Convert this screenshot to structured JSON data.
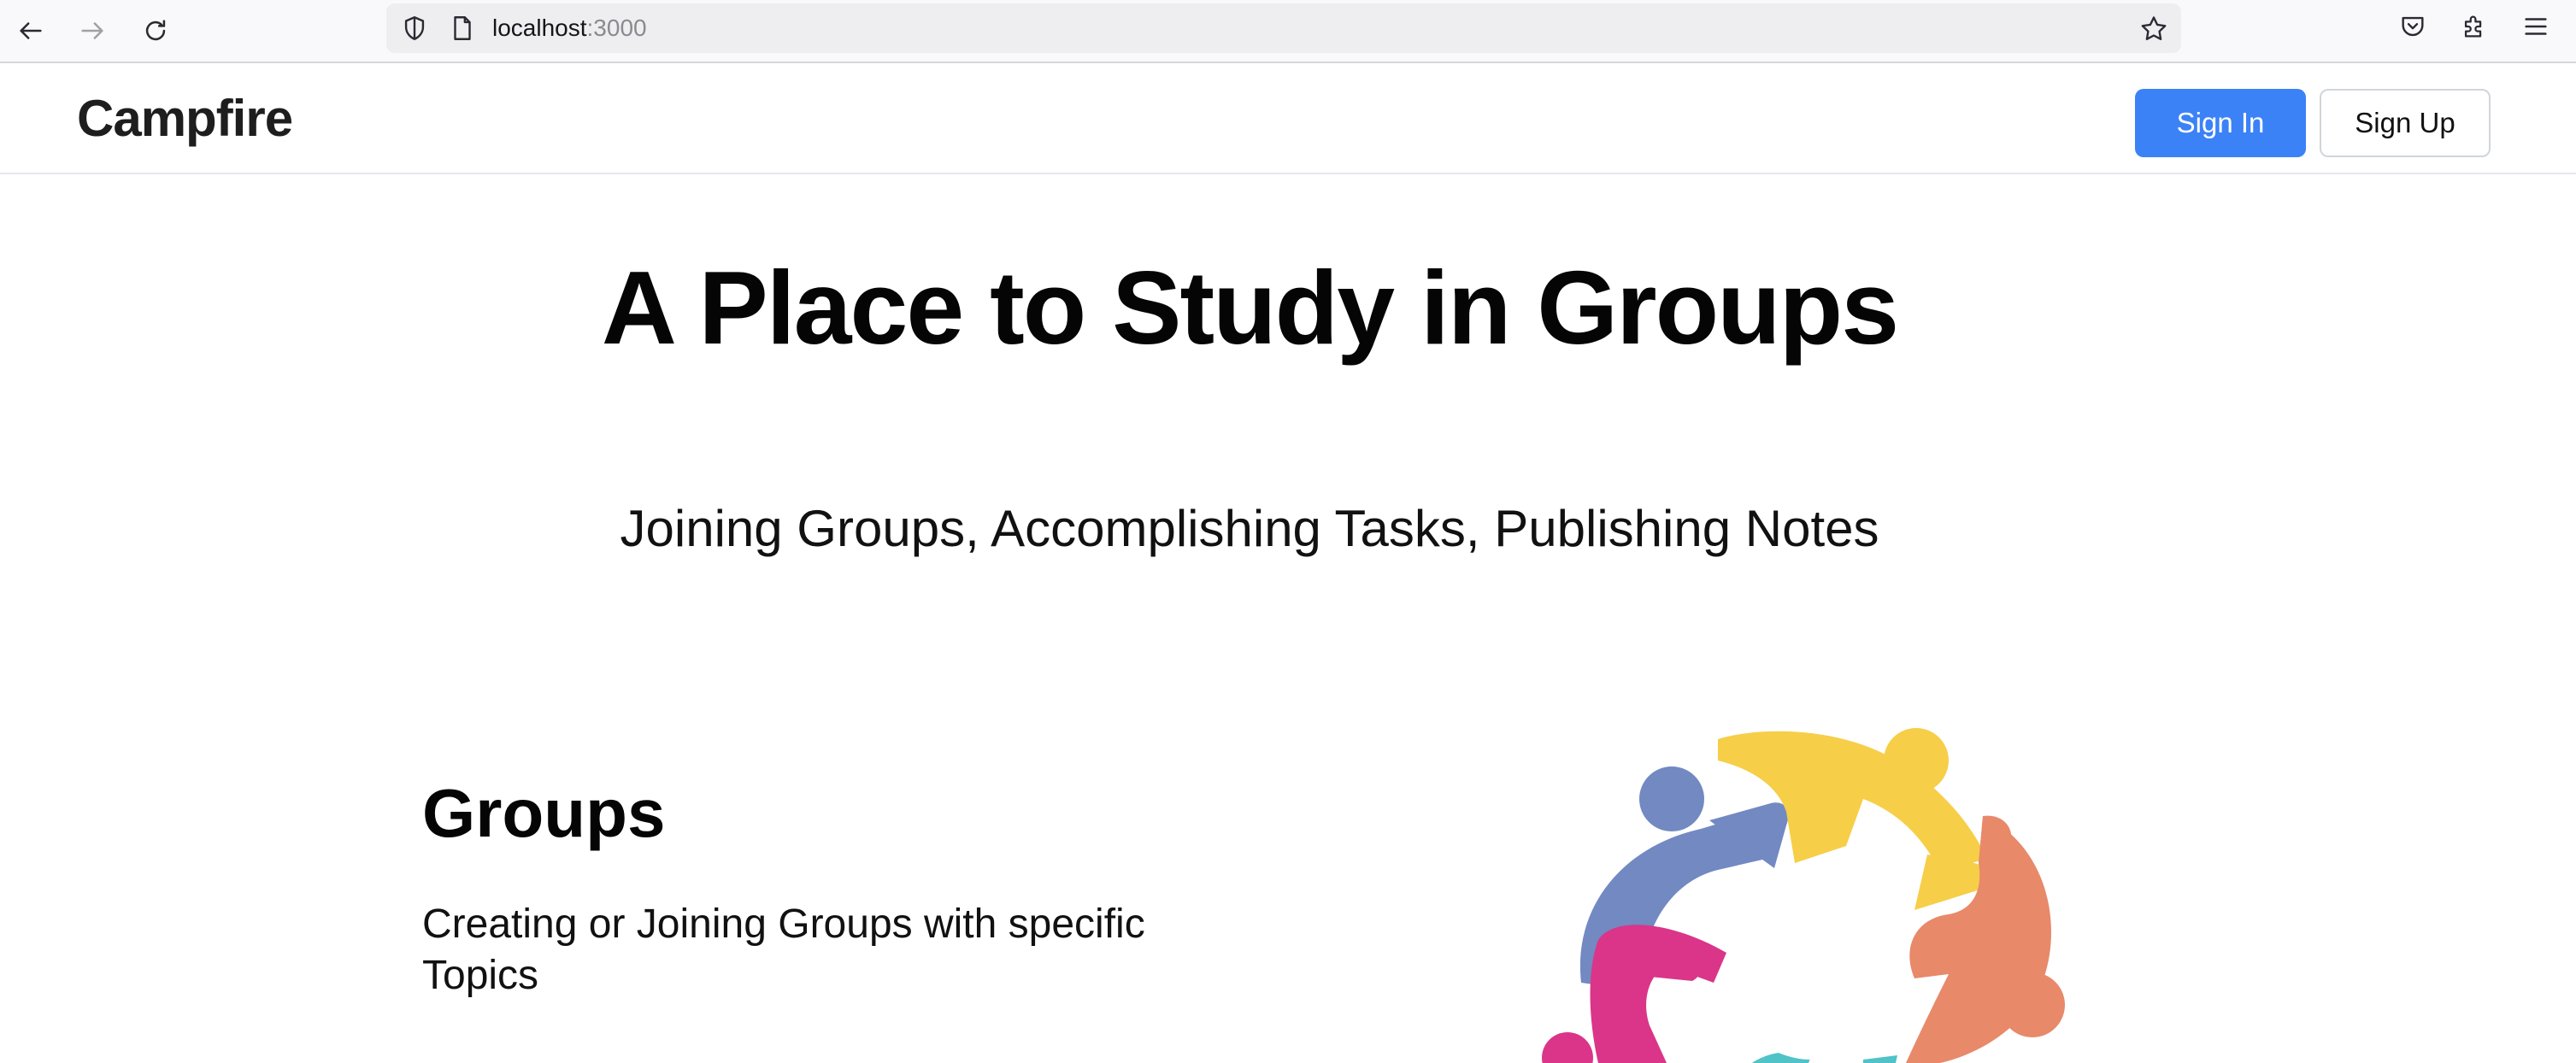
{
  "browser": {
    "url_host": "localhost",
    "url_port": ":3000",
    "icons": [
      "back-arrow-icon",
      "forward-arrow-icon",
      "reload-icon",
      "shield-icon",
      "page-icon",
      "star-icon",
      "pocket-icon",
      "extensions-icon",
      "menu-icon"
    ]
  },
  "header": {
    "brand": "Campfire",
    "sign_in": "Sign In",
    "sign_up": "Sign Up",
    "accent_color": "#3b82f6"
  },
  "hero": {
    "title": "A Place to Study in Groups",
    "subtitle": "Joining Groups, Accomplishing Tasks, Publishing Notes"
  },
  "features": [
    {
      "title": "Groups",
      "description": "Creating or Joining Groups with specific Topics",
      "illustration": "people-circle-icon",
      "colors": [
        "#7289c2",
        "#f6ce48",
        "#e8896a",
        "#da3589",
        "#4fc3c8"
      ]
    }
  ]
}
